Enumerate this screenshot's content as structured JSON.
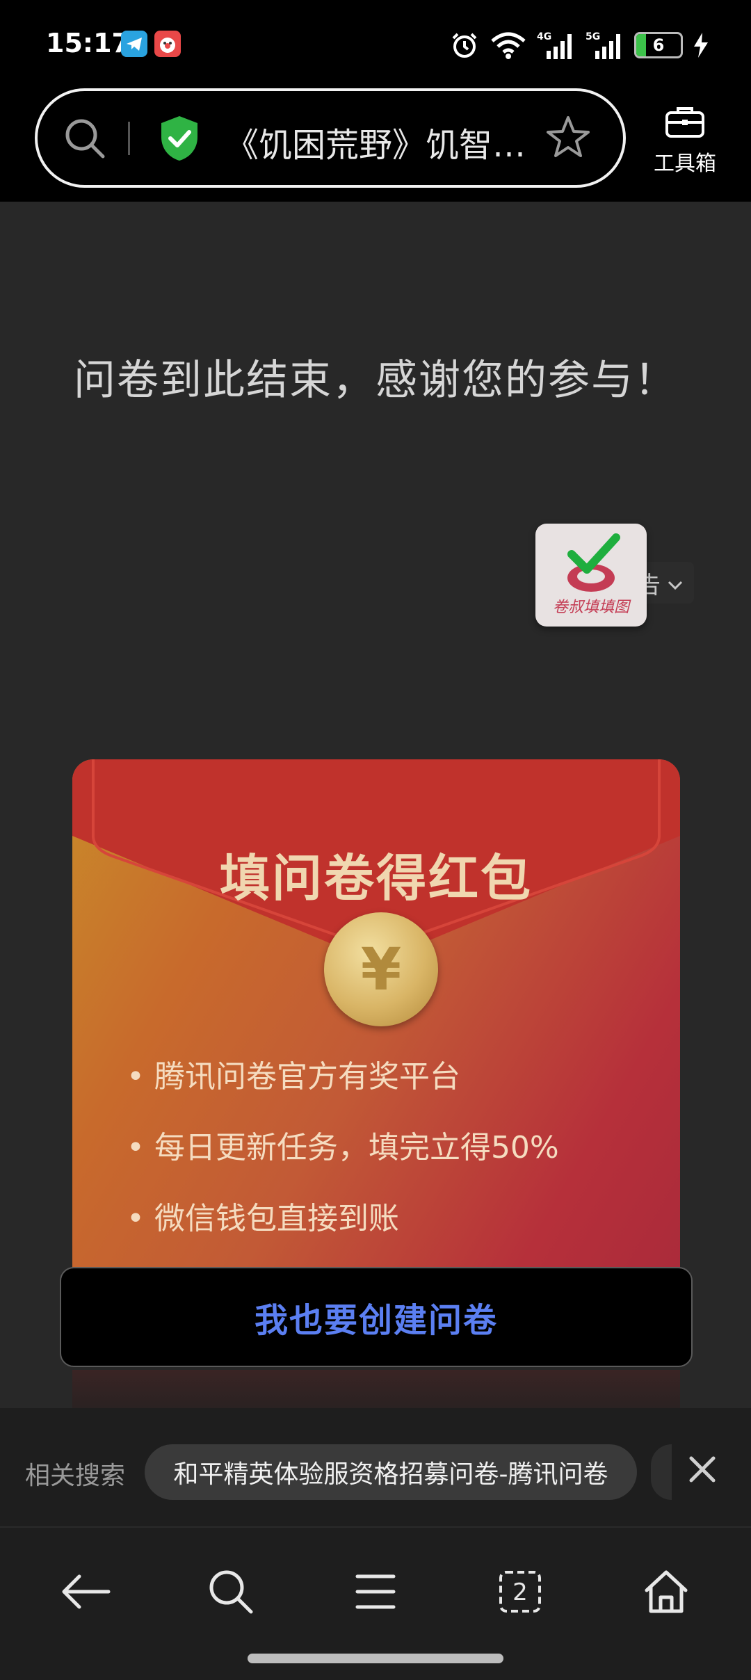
{
  "status_bar": {
    "time": "15:17",
    "battery_level": "6",
    "network_labels": [
      "4G",
      "5G"
    ],
    "icons": [
      "telegram-icon",
      "clown-app-icon",
      "alarm-icon",
      "wifi-icon",
      "signal-4g-icon",
      "signal-5g-icon",
      "battery-icon",
      "charging-icon"
    ]
  },
  "browser": {
    "url_title": "《饥困荒野》饥智…",
    "toolbox_label": "工具箱",
    "icons": [
      "search-icon",
      "shield-check-icon",
      "star-icon",
      "toolbox-icon"
    ]
  },
  "page": {
    "thanks_message": "问卷到此结束，感谢您的参与！",
    "ad_label": "广告"
  },
  "ad": {
    "title": "填问卷得红包",
    "coin_symbol": "¥",
    "bullets": [
      "• 腾讯问卷官方有奖平台",
      "• 每日更新任务，填完立得50%",
      "• 微信钱包直接到账"
    ],
    "badge_text": "卷叔填填图",
    "create_button": "我也要创建问卷"
  },
  "related_search": {
    "label": "相关搜索",
    "chip": "和平精英体验服资格招募问卷-腾讯问卷"
  },
  "bottom_nav": {
    "tab_count": "2",
    "items": [
      "back-icon",
      "search-icon",
      "menu-icon",
      "tabs-icon",
      "home-icon"
    ]
  },
  "colors": {
    "accent_blue": "#5b7ff2",
    "shield_green": "#2fb344",
    "ad_red": "#b6303a",
    "ad_gold": "#c98a2a"
  }
}
